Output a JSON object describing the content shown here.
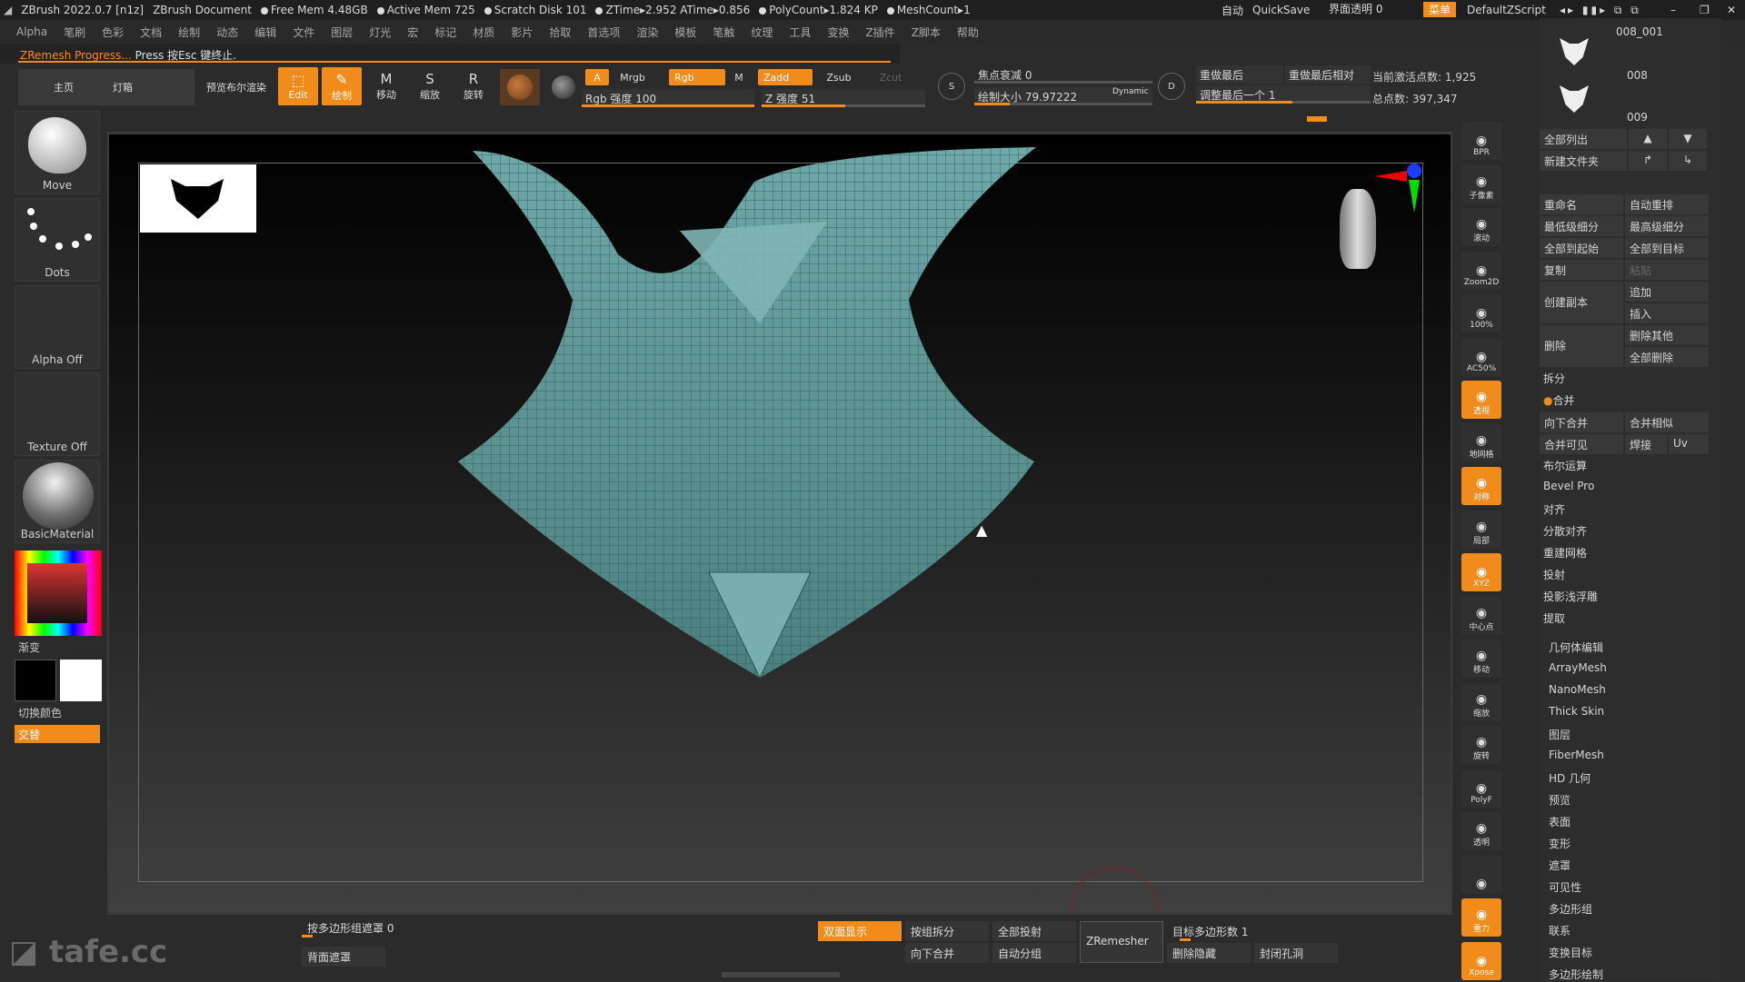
{
  "titlebar": {
    "app": "ZBrush 2022.0.7 [n1z]",
    "document": "ZBrush Document",
    "free_mem": "Free Mem 4.48GB",
    "active_mem": "Active Mem 725",
    "scratch": "Scratch Disk 101",
    "ztime": "ZTime▸2.952 ATime▸0.856",
    "polycount": "PolyCount▸1.824 KP",
    "meshcount": "MeshCount▸1",
    "auto": "自动",
    "quicksave": "QuickSave",
    "transparency": "界面透明 0",
    "menu_btn": "菜单",
    "script": "DefaultZScript"
  },
  "menubar": [
    "Alpha",
    "笔刷",
    "色彩",
    "文档",
    "绘制",
    "动态",
    "编辑",
    "文件",
    "图层",
    "灯光",
    "宏",
    "标记",
    "材质",
    "影片",
    "拾取",
    "首选项",
    "渲染",
    "模板",
    "笔触",
    "纹理",
    "工具",
    "变换",
    "Z插件",
    "Z脚本",
    "帮助"
  ],
  "progress": {
    "label": "ZRemesh Progress...",
    "hint": "Press 按Esc 键终止."
  },
  "toolbar": {
    "home": "主页",
    "lightbox": "灯箱",
    "preview": "预览布尔渲染",
    "edit": "Edit",
    "draw": "绘制",
    "move": "移动",
    "scale": "缩放",
    "rotate": "旋转",
    "a": "A",
    "mrgb": "Mrgb",
    "rgb": "Rgb",
    "m": "M",
    "zadd": "Zadd",
    "zsub": "Zsub",
    "zcut": "Zcut",
    "rgb_intensity": "Rgb 强度 100",
    "z_intensity": "Z 强度 51",
    "focal": "焦点衰减 0",
    "draw_size": "绘制大小 79.97222",
    "dynamic": "Dynamic",
    "redo_last": "重做最后",
    "redo_last_rel": "重做最后相对",
    "adjust_last": "调整最后一个 1",
    "active_points": "当前激活点数: 1,925",
    "total_points": "总点数: 397,347"
  },
  "left": {
    "move": "Move",
    "dots": "Dots",
    "alpha_off": "Alpha Off",
    "texture_off": "Texture Off",
    "material": "BasicMaterial",
    "gradient": "渐变",
    "switch_color": "切换颜色",
    "alternate": "交替"
  },
  "right_strip": [
    "BPR",
    "子像素",
    "滚动",
    "Zoom2D",
    "100%",
    "AC50%",
    "透视",
    "地网格",
    "对称",
    "局部",
    "XYZ",
    "中心点",
    "移动",
    "缩放",
    "旋转",
    "PolyF",
    "透明",
    "",
    "重力",
    "Xpose"
  ],
  "subtools": {
    "s1": "008_001",
    "s2": "008",
    "s3": "009"
  },
  "right_panel": {
    "list_all": "全部列出",
    "new_folder": "新建文件夹",
    "rename": "重命名",
    "auto_reorder": "自动重排",
    "lowest_sub": "最低级细分",
    "highest_sub": "最高级细分",
    "all_to_start": "全部到起始",
    "all_to_target": "全部到目标",
    "duplicate": "复制",
    "paste": "粘贴",
    "create_copy": "创建副本",
    "append": "追加",
    "insert": "插入",
    "delete": "删除",
    "delete_other": "删除其他",
    "delete_all": "全部删除",
    "split": "拆分",
    "merge": "合并",
    "merge_down": "向下合并",
    "merge_similar": "合并相似",
    "merge_visible": "合并可见",
    "weld": "焊接",
    "uv": "Uv",
    "boolean": "布尔运算",
    "bevel": "Bevel Pro",
    "align": "对齐",
    "distribute": "分散对齐",
    "remesh": "重建网格",
    "project": "投射",
    "project_bas": "投影浅浮雕",
    "extract": "提取",
    "menu": [
      "几何体编辑",
      "ArrayMesh",
      "NanoMesh",
      "Thick Skin",
      "图层",
      "FiberMesh",
      "HD 几何",
      "预览",
      "表面",
      "变形",
      "遮罩",
      "可见性",
      "多边形组",
      "联系",
      "变换目标",
      "多边形绘制"
    ]
  },
  "bottom": {
    "polygroup_mask": "按多边形组遮罩 0",
    "backface": "背面遮罩",
    "double": "双面显示",
    "group_split": "按组拆分",
    "all_project": "全部投射",
    "merge_down": "向下合并",
    "auto_group": "自动分组",
    "zremesher": "ZRemesher",
    "target_poly": "目标多边形数 1",
    "delete_hidden": "删除隐藏",
    "close_holes": "封闭孔洞"
  },
  "watermark": "tafe.cc",
  "colors": {
    "accent": "#f08b1c",
    "mesh": "#5f9a9a"
  }
}
